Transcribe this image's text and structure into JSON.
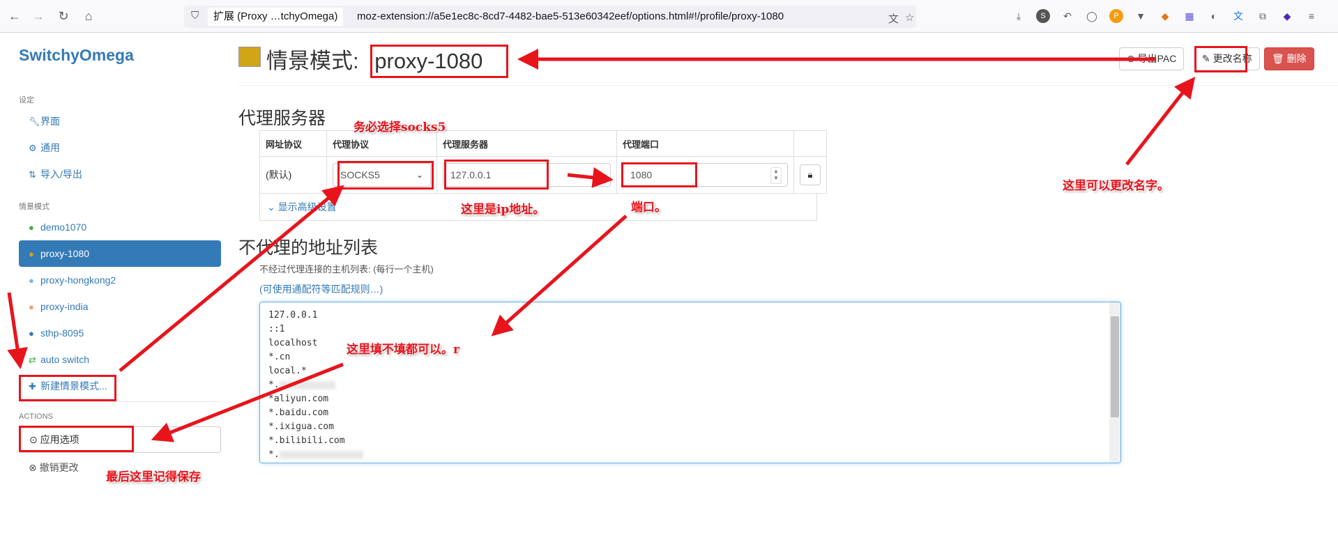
{
  "browser": {
    "identity_label": "扩展 (Proxy …tchyOmega)",
    "url": "moz-extension://a5e1ec8c-8cd7-4482-bae5-513e60342eef/options.html#!/profile/proxy-1080"
  },
  "sidebar": {
    "brand": "SwitchyOmega",
    "settings_header": "设定",
    "settings_items": [
      "界面",
      "通用",
      "导入/导出"
    ],
    "profiles_header": "情景模式",
    "profiles": [
      {
        "label": "demo1070",
        "color": "#3cb043"
      },
      {
        "label": "proxy-1080",
        "color": "#d0a617"
      },
      {
        "label": "proxy-hongkong2",
        "color": "#7ab8e8"
      },
      {
        "label": "proxy-india",
        "color": "#f0a070"
      },
      {
        "label": "sthp-8095",
        "color": "#337ab7"
      },
      {
        "label": "auto switch",
        "color": "#3cb043"
      }
    ],
    "new_profile": "新建情景模式...",
    "actions_header": "ACTIONS",
    "apply": "应用选项",
    "discard": "撤销更改"
  },
  "header": {
    "title_prefix": "情景模式:",
    "profile_name": "proxy-1080",
    "export_pac": "导出PAC",
    "rename": "更改名称",
    "delete": "删除",
    "profile_color": "#d0a617"
  },
  "proxy_servers": {
    "heading": "代理服务器",
    "columns": [
      "网址协议",
      "代理协议",
      "代理服务器",
      "代理端口"
    ],
    "row": {
      "scheme": "(默认)",
      "protocol": "SOCKS5",
      "server": "127.0.0.1",
      "port": "1080"
    },
    "advanced": "显示高级设置"
  },
  "bypass": {
    "heading": "不代理的地址列表",
    "help": "不经过代理连接的主机列表: (每行一个主机)",
    "wildcard_link": "(可使用通配符等匹配规则…)",
    "lines": [
      "127.0.0.1",
      "::1",
      "localhost",
      "*.cn",
      "local.*",
      "*.",
      "*aliyun.com",
      "*.baidu.com",
      "*.ixigua.com",
      "*.bilibili.com",
      "*."
    ]
  },
  "annotations": {
    "must_socks5": "务必选择socks5",
    "ip_address": "这里是ip地址。",
    "port": "端口。",
    "rename_hint": "这里可以更改名字。",
    "optional": "这里填不填都可以。r",
    "save_hint": "最后这里记得保存",
    "color": "#e8141c"
  }
}
